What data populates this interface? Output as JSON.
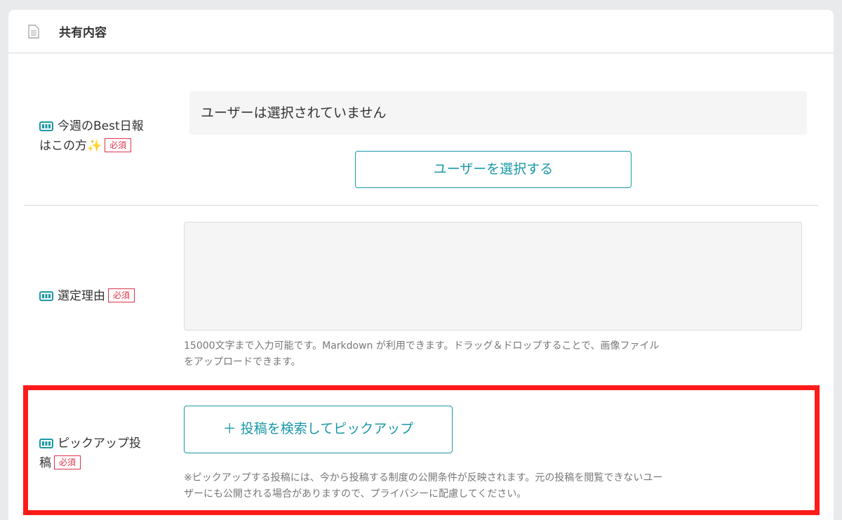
{
  "card": {
    "title": "共有内容",
    "icon": "document-icon"
  },
  "best_report": {
    "label_line1": "今週のBest日報",
    "label_line2": "はこの方",
    "sparkle": "✨",
    "required": "必須",
    "user_display": "ユーザーは選択されていません",
    "select_button": "ユーザーを選択する"
  },
  "reason": {
    "label": "選定理由",
    "required": "必須",
    "textarea_value": "",
    "hint_line1": "15000文字まで入力可能です。Markdown が利用できます。ドラッグ＆ドロップすることで、画像ファイル",
    "hint_line2": "をアップロードできます。"
  },
  "pickup": {
    "label_line1": "ピックアップ投",
    "label_line2": "稿",
    "required": "必須",
    "button": "＋ 投稿を検索してピックアップ",
    "note_line1": "※ピックアップする投稿には、今から投稿する制度の公開条件が反映されます。元の投稿を閲覧できないユー",
    "note_line2": "ザーにも公開される場合がありますので、プライバシーに配慮してください。"
  },
  "colors": {
    "accent": "#1a98a6",
    "required": "#e0334a",
    "highlight": "#ff1a1a"
  }
}
